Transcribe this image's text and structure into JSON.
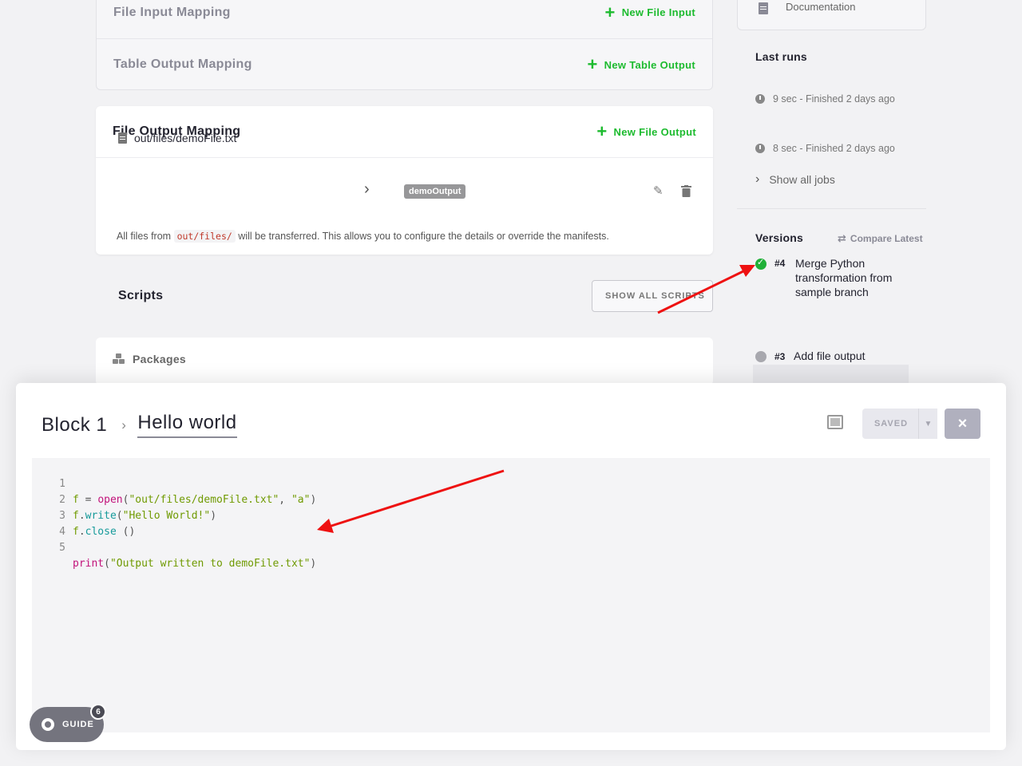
{
  "mapping": {
    "file_input": {
      "title": "File Input Mapping",
      "action": "New File Input"
    },
    "table_output": {
      "title": "Table Output Mapping",
      "action": "New Table Output"
    },
    "file_output": {
      "title": "File Output Mapping",
      "action": "New File Output",
      "file_path": "out/files/demoFile.txt",
      "tag": "demoOutput",
      "note_prefix": "All files from",
      "note_code": "out/files/",
      "note_suffix": "will be transferred. This allows you to configure the details or override the manifests."
    }
  },
  "scripts": {
    "title": "Scripts",
    "show_all": "SHOW ALL SCRIPTS"
  },
  "packages": {
    "title": "Packages"
  },
  "sidebar": {
    "documentation": "Documentation",
    "last_runs_title": "Last runs",
    "runs": [
      "9 sec - Finished 2 days ago",
      "8 sec - Finished 2 days ago"
    ],
    "show_all_jobs": "Show all jobs",
    "versions_title": "Versions",
    "compare_latest": "Compare Latest",
    "versions": [
      {
        "num": "#4",
        "text": "Merge Python transformation from sample branch",
        "status": "success"
      },
      {
        "num": "#3",
        "text": "Add file output",
        "status": "inactive"
      }
    ]
  },
  "modal": {
    "crumb_parent": "Block 1",
    "crumb_current": "Hello world",
    "saved_label": "SAVED",
    "close_icon": "×"
  },
  "code_lines": [
    {
      "n": "1",
      "text": "f = open(\"out/files/demoFile.txt\", \"a\")"
    },
    {
      "n": "2",
      "text": "f.write(\"Hello World!\")"
    },
    {
      "n": "3",
      "text": "f.close ()"
    },
    {
      "n": "4",
      "text": ""
    },
    {
      "n": "5",
      "text": "print(\"Output written to demoFile.txt\")"
    }
  ],
  "guide": {
    "label": "GUIDE",
    "count": "6"
  },
  "colors": {
    "accent_green": "#1dbb2f",
    "arrow_red": "#ee1111",
    "success_green": "#20b038"
  }
}
